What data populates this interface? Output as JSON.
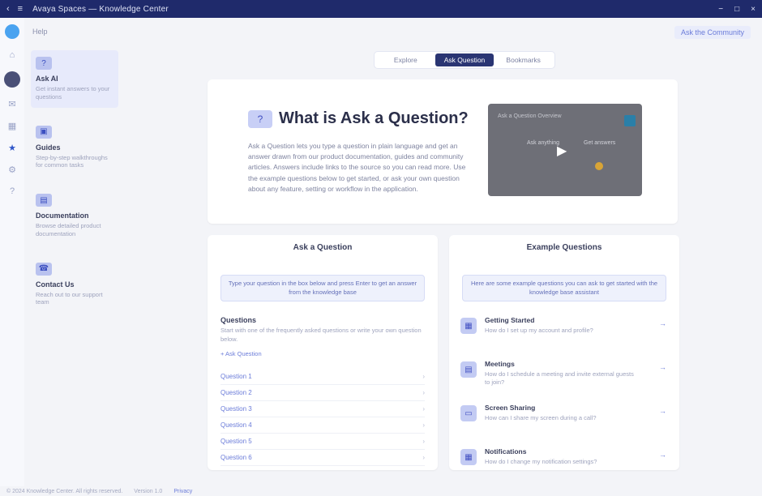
{
  "titlebar": {
    "title": "Avaya Spaces — Knowledge Center",
    "icons": [
      "back-icon",
      "menu-icon"
    ],
    "controls": [
      "−",
      "□",
      "×"
    ]
  },
  "breadcrumb": "Help",
  "top_right_link": "Ask the Community",
  "rail": {
    "icons": [
      "home-icon",
      "chat-icon",
      "calendar-icon",
      "star-icon",
      "settings-icon",
      "help-icon"
    ]
  },
  "sidebar": {
    "items": [
      {
        "icon": "?",
        "title": "Ask AI",
        "desc": "Get instant answers to your questions",
        "active": true
      },
      {
        "icon": "▣",
        "title": "Guides",
        "desc": "Step-by-step walkthroughs for common tasks"
      },
      {
        "icon": "▤",
        "title": "Documentation",
        "desc": "Browse detailed product documentation"
      },
      {
        "icon": "☎",
        "title": "Contact Us",
        "desc": "Reach out to our support team"
      }
    ]
  },
  "tabs": {
    "items": [
      {
        "label": "Explore"
      },
      {
        "label": "Ask Question",
        "active": true
      },
      {
        "label": "Bookmarks"
      }
    ]
  },
  "hero": {
    "icon": "?",
    "title": "What is Ask a Question?",
    "body": "Ask a Question lets you type a question in plain language and get an answer drawn from our product documentation, guides and community articles. Answers include links to the source so you can read more. Use the example questions below to get started, or ask your own question about any feature, setting or workflow in the application.",
    "video": {
      "header": "Ask a Question Overview",
      "caption_left": "Ask anything",
      "caption_right": "Get answers"
    }
  },
  "left_panel": {
    "title": "Ask a Question",
    "banner": "Type your question in the box below and press Enter to get an answer from the knowledge base",
    "question_title": "Questions",
    "question_text": "Start with one of the frequently asked questions or write your own question below.",
    "question_link": "+ Ask Question",
    "rows": [
      "Question 1",
      "Question 2",
      "Question 3",
      "Question 4",
      "Question 5",
      "Question 6"
    ],
    "chevron": "›"
  },
  "right_panel": {
    "title": "Example Questions",
    "banner": "Here are some example questions you can ask to get started with the knowledge base assistant",
    "items": [
      {
        "icon": "▦",
        "title": "Getting Started",
        "desc": "How do I set up my account and profile?"
      },
      {
        "icon": "▤",
        "title": "Meetings",
        "desc": "How do I schedule a meeting and invite external guests to join?"
      },
      {
        "icon": "▭",
        "title": "Screen Sharing",
        "desc": "How can I share my screen during a call?"
      },
      {
        "icon": "▦",
        "title": "Notifications",
        "desc": "How do I change my notification settings?"
      }
    ],
    "go": "→"
  },
  "footer": {
    "text": "© 2024 Knowledge Center. All rights reserved.",
    "version": "Version 1.0",
    "link": "Privacy"
  }
}
